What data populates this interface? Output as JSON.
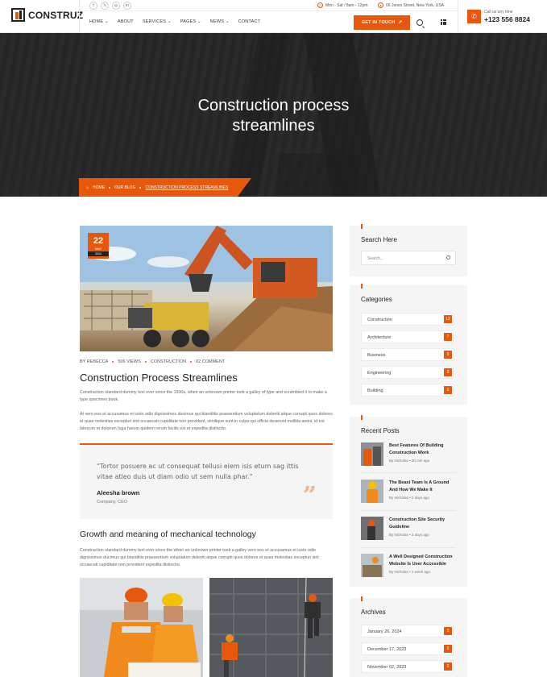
{
  "header": {
    "logo_text": "CONSTRUZ",
    "social": [
      "f",
      "𝕏",
      "◎",
      "in"
    ],
    "hours": "Mon - Sat / 8am - 12pm",
    "address": "06 Jones Street, New York, USA",
    "nav": [
      "HOME",
      "ABOUT",
      "SERVICES",
      "PAGES",
      "NEWS",
      "CONTACT"
    ],
    "nav_dropdown": [
      true,
      false,
      true,
      true,
      true,
      false
    ],
    "cta_label": "GET IN TOUCH",
    "call_label": "Call us any time",
    "phone": "+123 556 8824"
  },
  "hero": {
    "title_line1": "Construction process",
    "title_line2": "streamlines",
    "breadcrumb": [
      "HOME",
      "OUR BLOG",
      "CONSTRUCTION PROCESS STREAMLINES"
    ]
  },
  "post": {
    "date_day": "22",
    "date_month": "MAY",
    "date_year": "2024",
    "author": "BY REBECCA",
    "views": "506 VIEWS",
    "category": "CONSTRUCTION",
    "comments": "02 COMMENT",
    "title": "Construction Process Streamlines",
    "para1": "Construction standard dummy text ever since the 1500s, when an unknown printer took a galley of type and scrambled it to make a type specimen book.",
    "para2": "At vero eos et accusamus et iusto odio dignissimos ducimus qui blanditiis praesentium voluptatum deleniti atque corrupti quos dolores et quas molestias excepturi sint occaecati cupiditate non provident, similique sunt in culpa qui officia deserunt mollitia animi, id est laborum et dolorum fuga harum quidem rerum facilis est et expedita distinctio.",
    "quote": "“Tortor posuere ac ut consequat tellusi elem isis etum sag ittis vitae atleo duis ut diam odio ut sem nulla phar.”",
    "quote_name": "Aleesha brown",
    "quote_role": "Company, CEO",
    "subtitle": "Growth and meaning of mechanical technology",
    "para3": "Construction standard dummy text ever since the when an unknown printer took a galley vero eos et accusamus et iusto odio dignissimos ducimus qui blanditiis praesentium voluptatum deleniti atque corrupti quos dolores et quas molestias excepturi sint occaecati cupiditate non provident expedita distinctio."
  },
  "sidebar": {
    "search_title": "Search Here",
    "search_placeholder": "Search...",
    "categories_title": "Categories",
    "categories": [
      {
        "name": "Construction",
        "count": "12"
      },
      {
        "name": "Architecture",
        "count": "7"
      },
      {
        "name": "Business",
        "count": "5"
      },
      {
        "name": "Engineering",
        "count": "3"
      },
      {
        "name": "Building",
        "count": "2"
      }
    ],
    "recent_title": "Recent Posts",
    "recent": [
      {
        "title": "Best Features Of Building Construction Work",
        "author": "By Nicholas",
        "time": "30 min ago"
      },
      {
        "title": "The Beast Team Is A Ground And How We Make It",
        "author": "By Nicholas",
        "time": "2 days ago"
      },
      {
        "title": "Construction Site Security Guideline",
        "author": "By Nicholas",
        "time": "3 days ago"
      },
      {
        "title": "A Well Designed Construction Website Is User Accessible",
        "author": "By Nicholas",
        "time": "1 week ago"
      }
    ],
    "archives_title": "Archives",
    "archives": [
      {
        "date": "January 26, 2024",
        "count": "3"
      },
      {
        "date": "December 17, 2023",
        "count": "5"
      },
      {
        "date": "November 02, 2023",
        "count": "2"
      }
    ]
  }
}
